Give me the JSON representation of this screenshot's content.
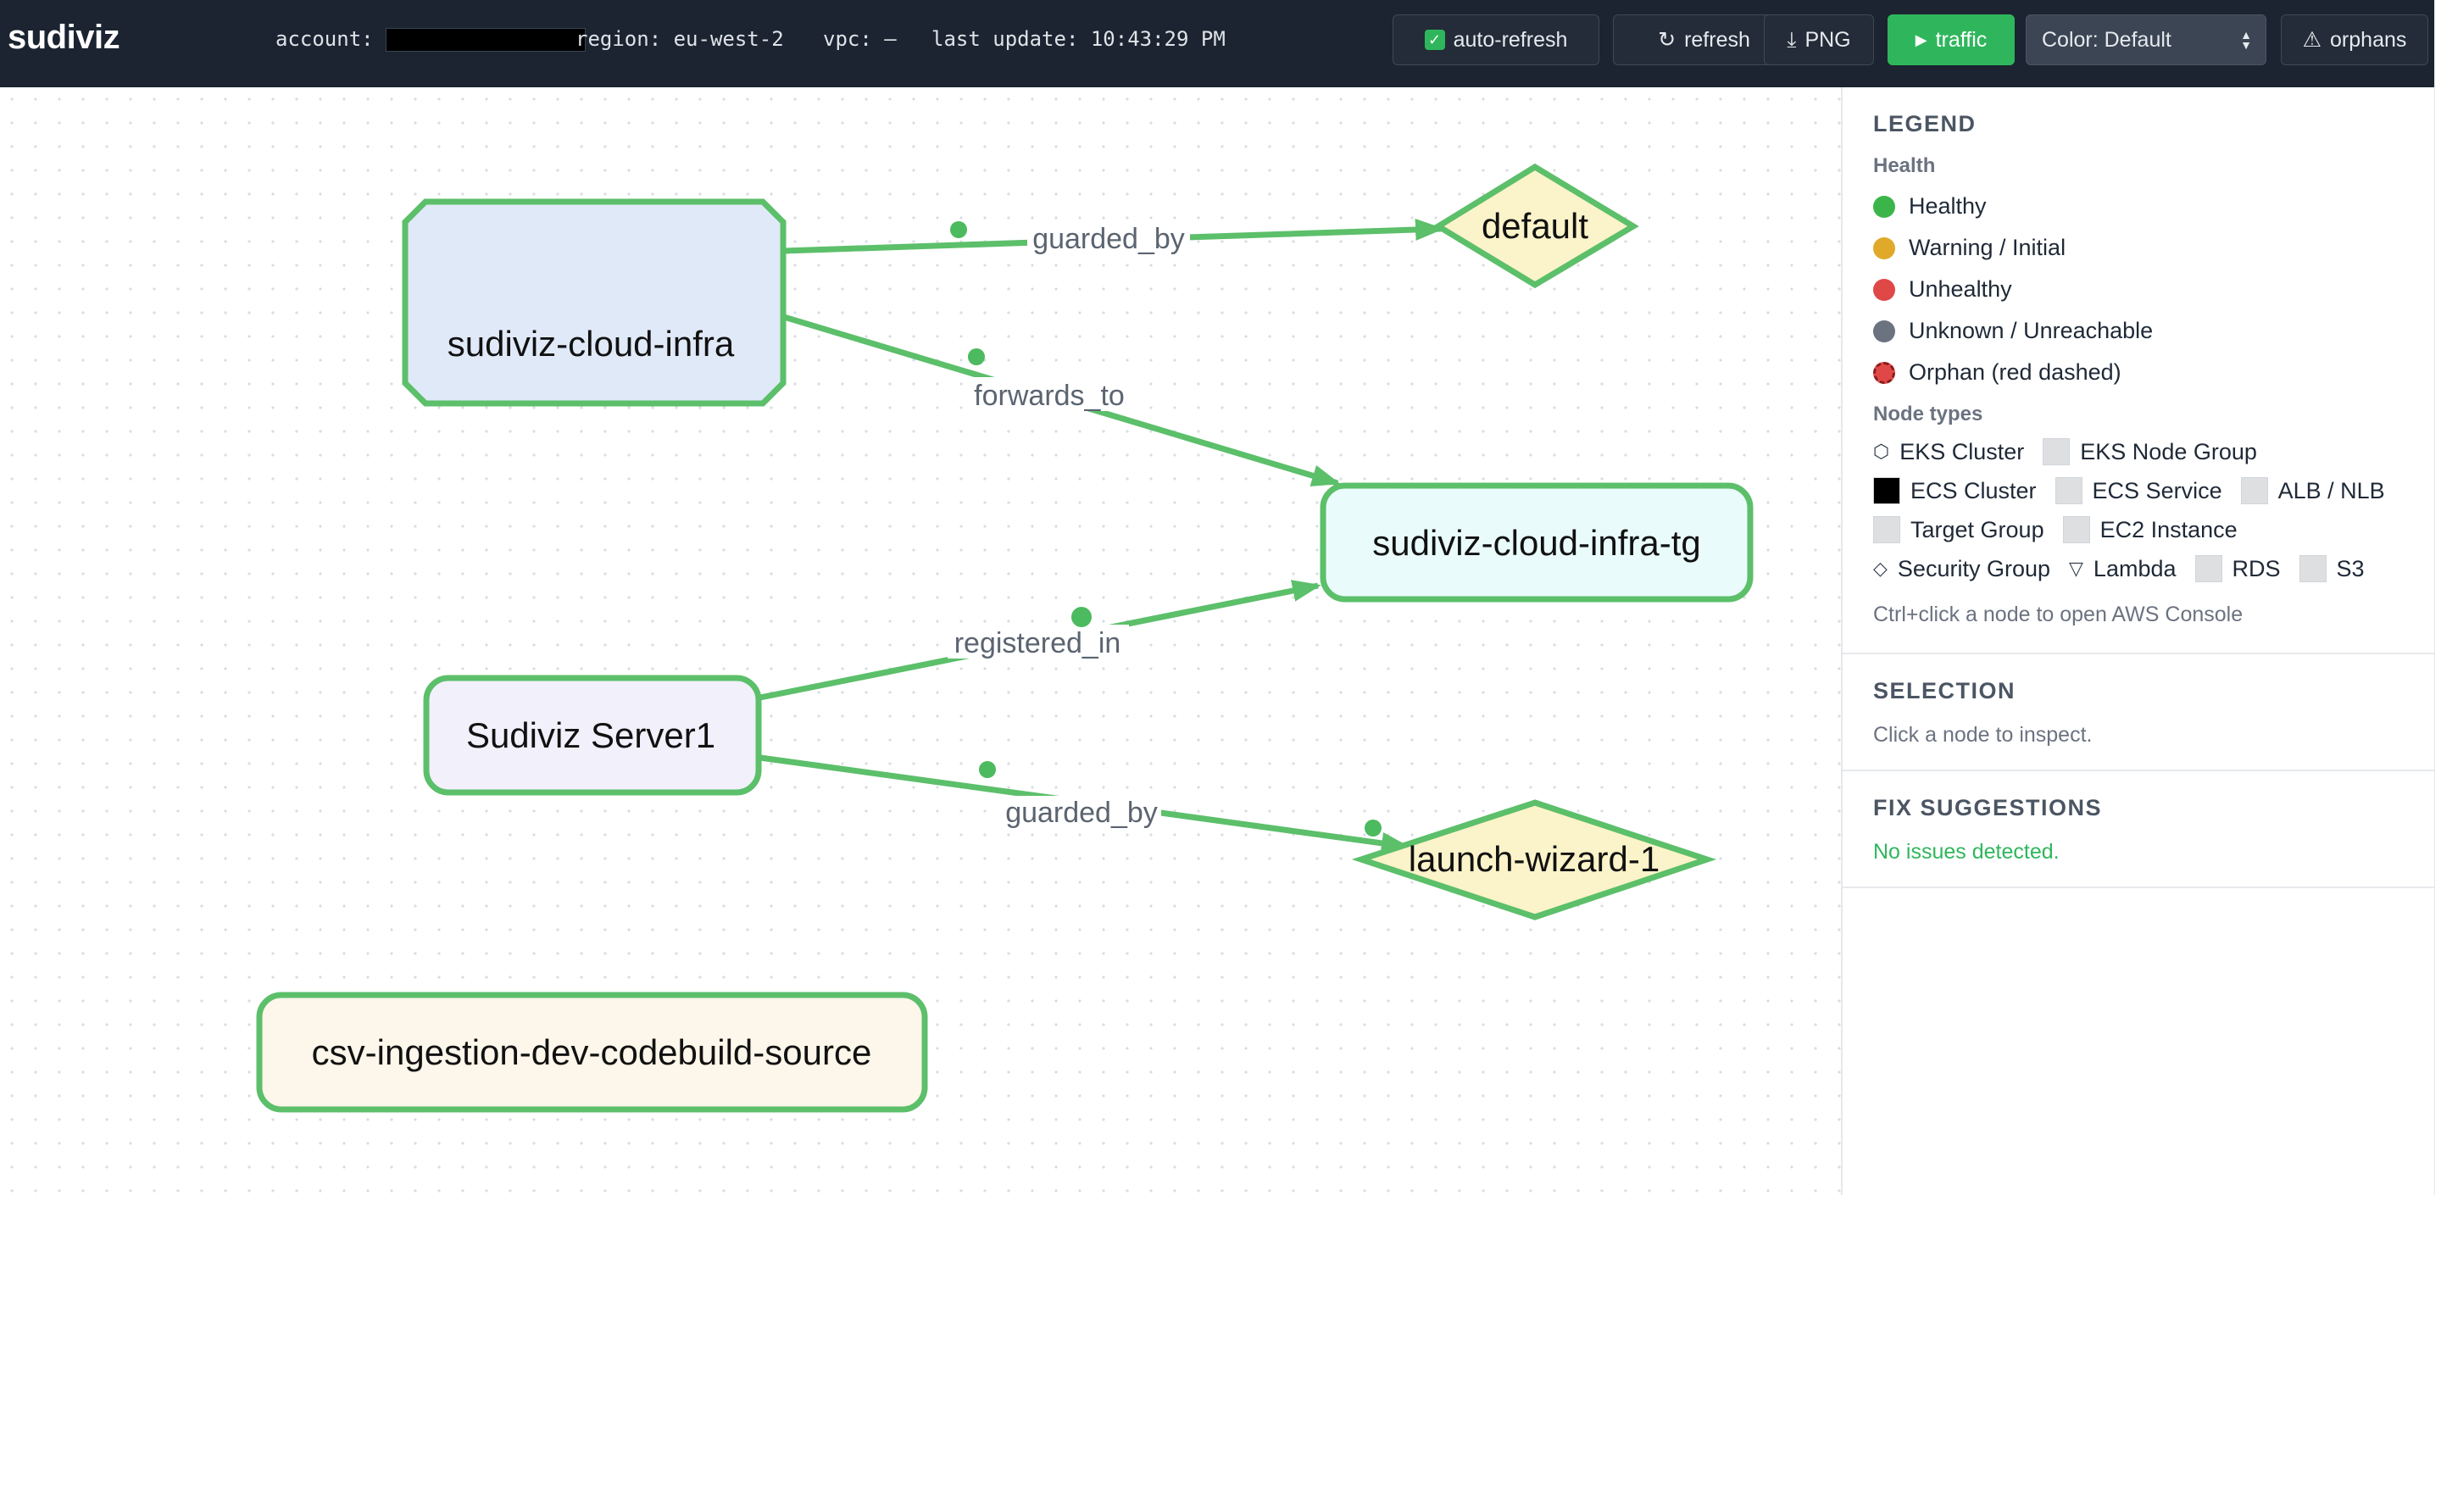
{
  "app": {
    "brand": "sudiviz"
  },
  "header": {
    "account_label": "account:",
    "region": "region: eu-west-2",
    "vpc": "vpc: —",
    "last_update": "last update: 10:43:29 PM"
  },
  "toolbar": {
    "auto_refresh": {
      "label": "auto-refresh",
      "checked": true
    },
    "refresh": {
      "label": "refresh",
      "icon": "refresh-icon"
    },
    "png": {
      "label": "PNG",
      "icon": "download-icon"
    },
    "traffic": {
      "label": "traffic",
      "icon": "play-icon"
    },
    "color_select": {
      "value": "Color: Default"
    },
    "orphans": {
      "label": "orphans",
      "icon": "warning-icon"
    }
  },
  "graph": {
    "nodes": [
      {
        "id": "n1",
        "label": "sudiviz-cloud-infra",
        "type": "EKS Cluster",
        "health": "Healthy"
      },
      {
        "id": "n2",
        "label": "default",
        "type": "Security Group",
        "health": "Healthy"
      },
      {
        "id": "n3",
        "label": "sudiviz-cloud-infra-tg",
        "type": "Target Group",
        "health": "Healthy"
      },
      {
        "id": "n4",
        "label": "Sudiviz Server1",
        "type": "EC2 Instance",
        "health": "Healthy"
      },
      {
        "id": "n5",
        "label": "launch-wizard-1",
        "type": "Security Group",
        "health": "Healthy"
      },
      {
        "id": "n6",
        "label": "csv-ingestion-dev-codebuild-source",
        "type": "S3",
        "health": "Healthy"
      }
    ],
    "edges": [
      {
        "from": "sudiviz-cloud-infra",
        "to": "default",
        "label": "guarded_by"
      },
      {
        "from": "sudiviz-cloud-infra",
        "to": "sudiviz-cloud-infra-tg",
        "label": "forwards_to"
      },
      {
        "from": "Sudiviz Server1",
        "to": "sudiviz-cloud-infra-tg",
        "label": "registered_in"
      },
      {
        "from": "Sudiviz Server1",
        "to": "launch-wizard-1",
        "label": "guarded_by"
      }
    ],
    "edge_color": "#5cbf6a"
  },
  "legend": {
    "title": "LEGEND",
    "health_title": "Health",
    "health": [
      {
        "label": "Healthy",
        "color": "#3bb54a"
      },
      {
        "label": "Warning / Initial",
        "color": "#e0a92a"
      },
      {
        "label": "Unhealthy",
        "color": "#e04848"
      },
      {
        "label": "Unknown / Unreachable",
        "color": "#6b7280"
      },
      {
        "label": "Orphan (red dashed)",
        "color": "#e04848"
      }
    ],
    "node_types_title": "Node types",
    "node_types": [
      {
        "label": "EKS Cluster",
        "icon": "hexagon-icon"
      },
      {
        "label": "EKS Node Group",
        "icon": "square-swatch"
      },
      {
        "label": "ECS Cluster",
        "icon": "dark-swatch"
      },
      {
        "label": "ECS Service",
        "icon": "square-swatch"
      },
      {
        "label": "ALB / NLB",
        "icon": "square-swatch"
      },
      {
        "label": "Target Group",
        "icon": "square-swatch"
      },
      {
        "label": "EC2 Instance",
        "icon": "square-swatch"
      },
      {
        "label": "Security Group",
        "icon": "diamond-icon"
      },
      {
        "label": "Lambda",
        "icon": "triangle-icon"
      },
      {
        "label": "RDS",
        "icon": "square-swatch"
      },
      {
        "label": "S3",
        "icon": "square-swatch"
      }
    ],
    "hint": "Ctrl+click a node to open AWS Console"
  },
  "selection": {
    "title": "SELECTION",
    "text": "Click a node to inspect."
  },
  "fixes": {
    "title": "FIX SUGGESTIONS",
    "text": "No issues detected."
  }
}
